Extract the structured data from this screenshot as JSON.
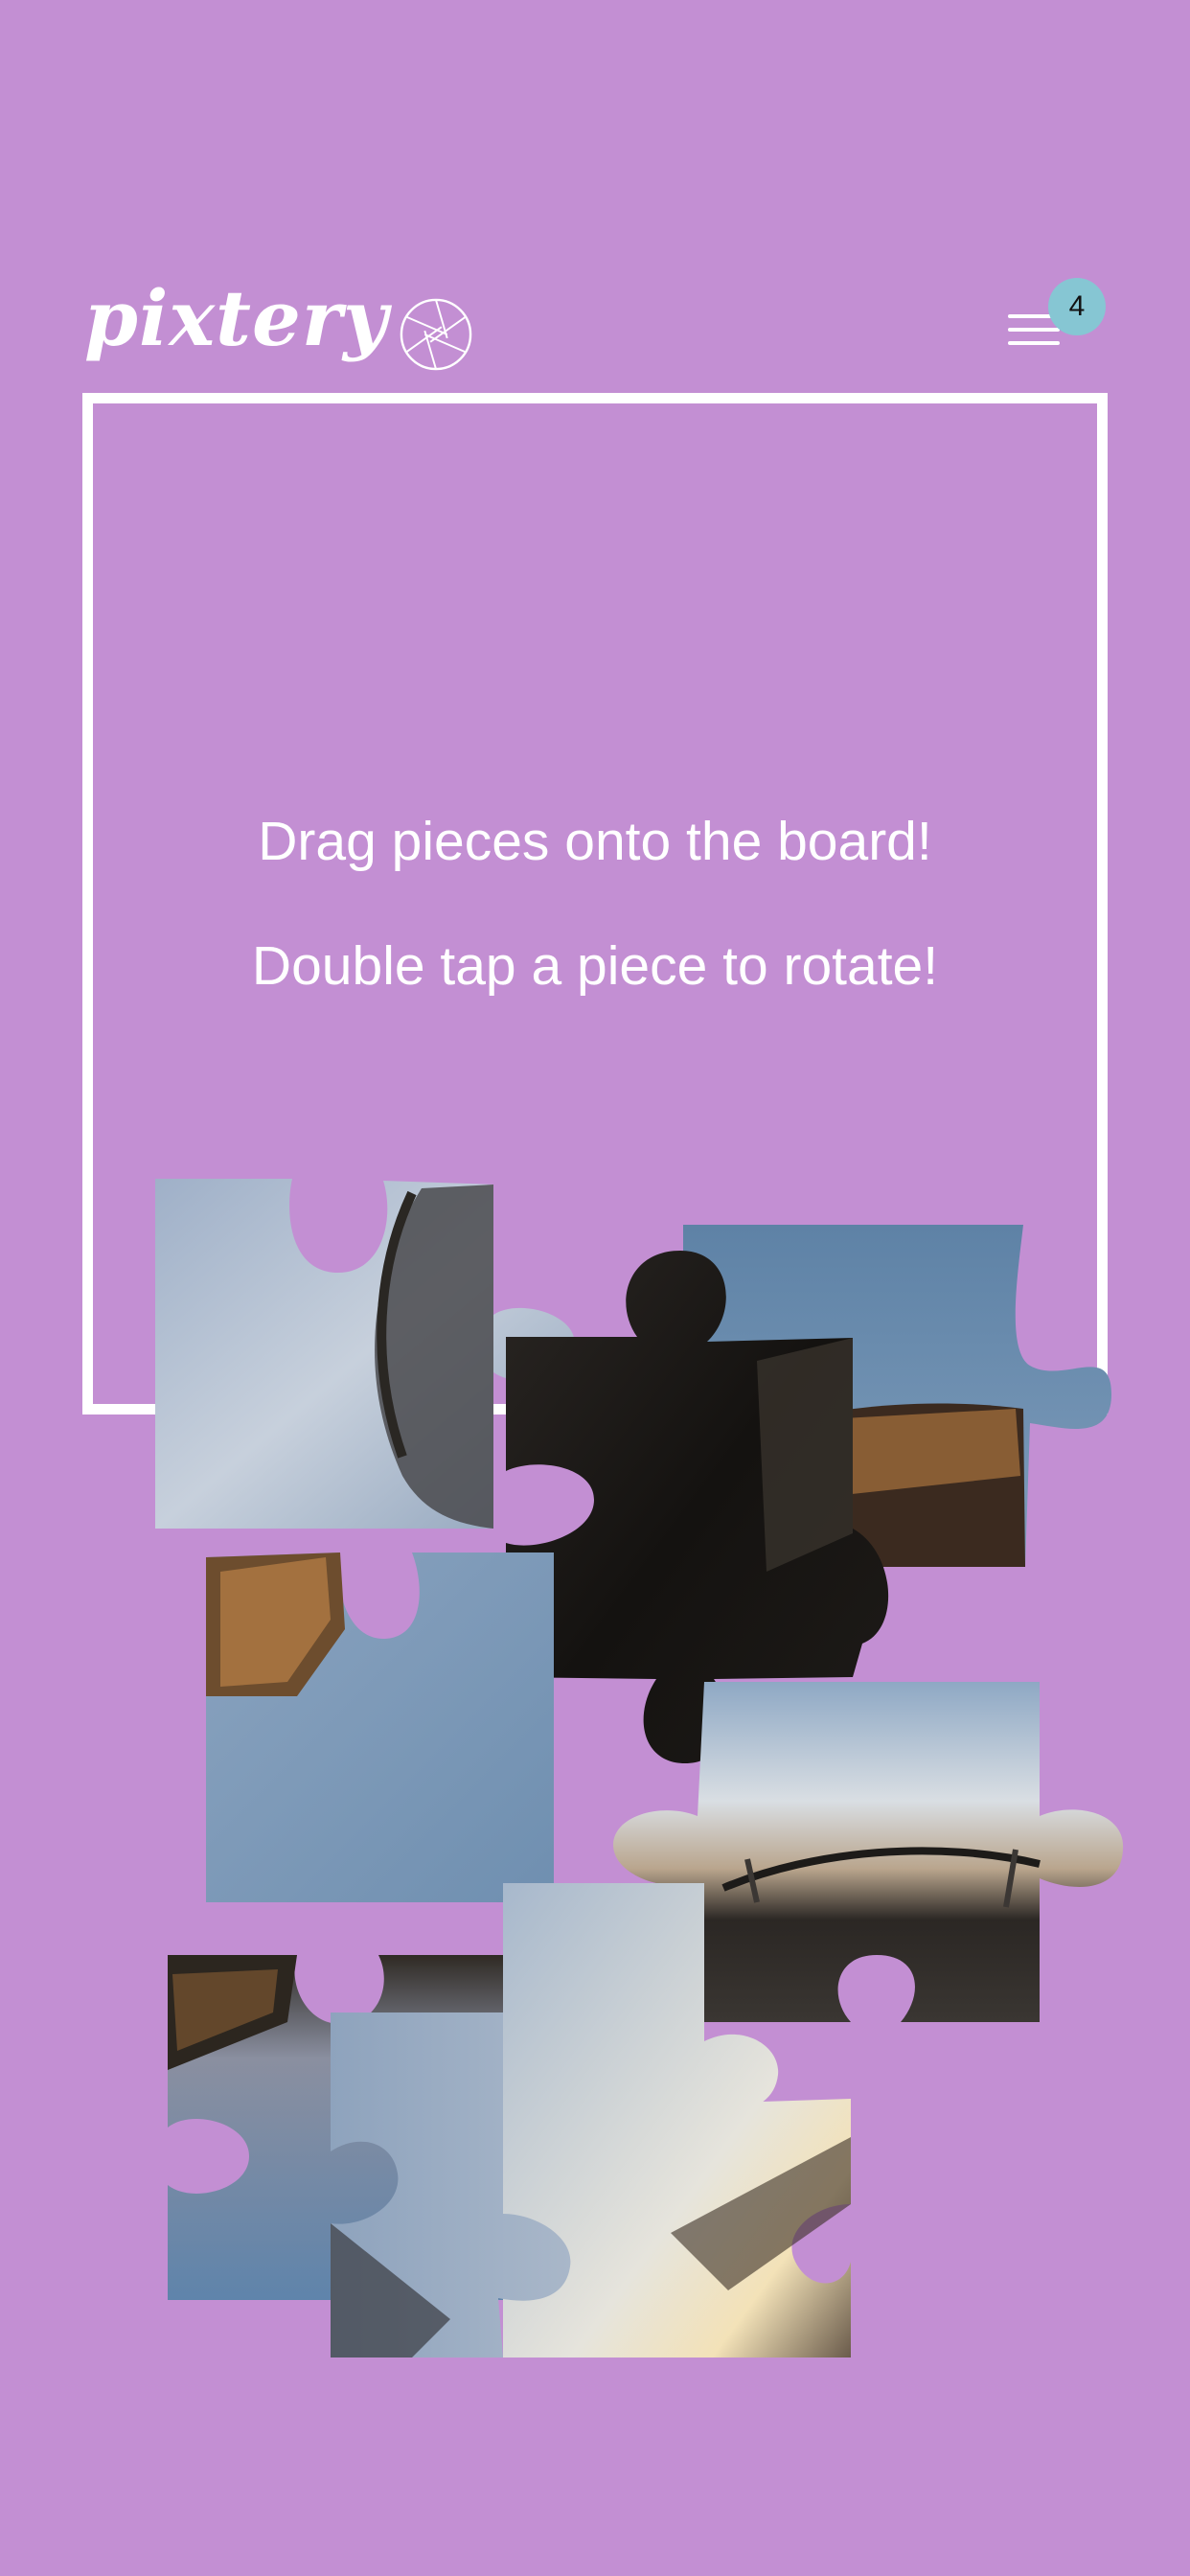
{
  "app": {
    "logo_text": "pixtery"
  },
  "menu": {
    "badge_count": "4"
  },
  "board": {
    "hint_drag": "Drag pieces onto the board!",
    "hint_rotate": "Double tap a piece to rotate!"
  },
  "colors": {
    "background": "#c38fd3",
    "board_border": "#ffffff",
    "badge": "#86c6d3"
  },
  "icons": {
    "logo": "camera-aperture-icon",
    "menu": "hamburger-menu-icon"
  }
}
